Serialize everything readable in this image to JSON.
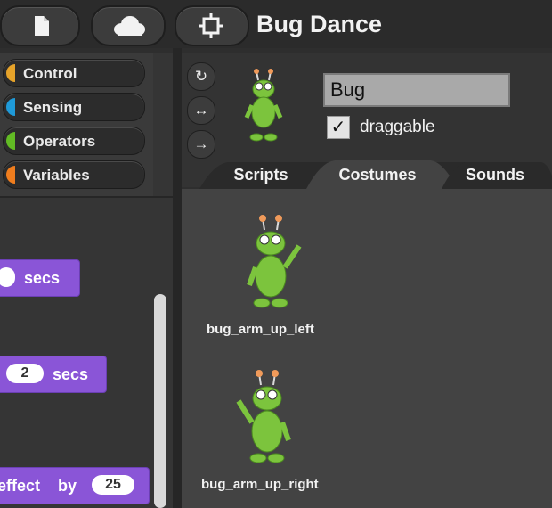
{
  "toolbar": {
    "file_icon": "file-icon",
    "cloud_icon": "cloud-icon",
    "settings_icon": "settings-gear-icon",
    "project_title": "Bug Dance"
  },
  "categories": [
    {
      "label": "Control",
      "color": "#e6a32a"
    },
    {
      "label": "Sensing",
      "color": "#1f9ad8"
    },
    {
      "label": "Operators",
      "color": "#62bb24"
    },
    {
      "label": "Variables",
      "color": "#ef7d1e"
    }
  ],
  "blocks": {
    "block1_suffix": "secs",
    "block2_value": "2",
    "block2_suffix": "secs",
    "block3_prefix": "effect",
    "block3_by": "by",
    "block3_value": "25"
  },
  "sprite": {
    "name": "Bug",
    "draggable_label": "draggable",
    "draggable_checked": true,
    "check_glyph": "✓",
    "rotation_buttons": [
      "↻",
      "↔",
      "→"
    ]
  },
  "tabs": [
    {
      "label": "Scripts",
      "active": false
    },
    {
      "label": "Costumes",
      "active": true
    },
    {
      "label": "Sounds",
      "active": false
    }
  ],
  "costumes": [
    {
      "name": "bug_arm_up_left"
    },
    {
      "name": "bug_arm_up_right"
    }
  ],
  "colors": {
    "block_purple": "#8a55d7",
    "bug_green": "#7cc43d",
    "antenna_orange": "#f09a5a"
  }
}
